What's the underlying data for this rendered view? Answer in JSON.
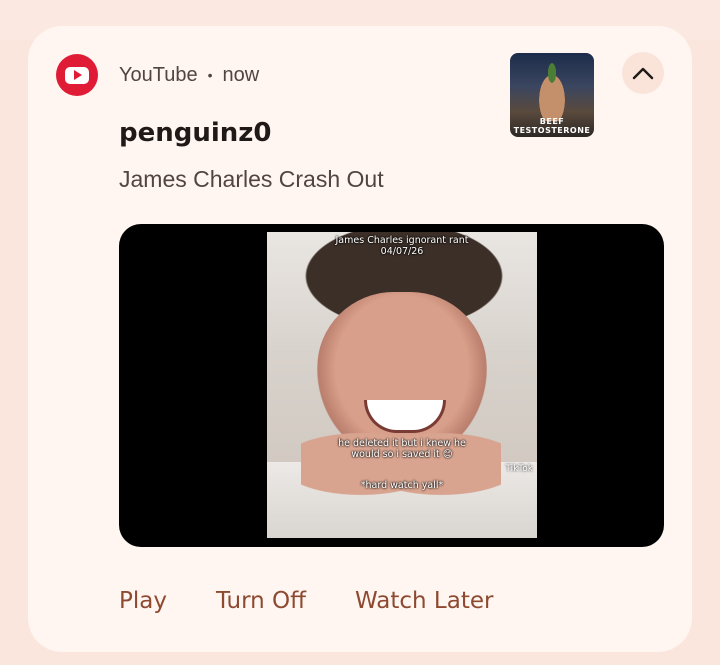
{
  "notification": {
    "app_name": "YouTube",
    "separator": "•",
    "time": "now",
    "title": "penguinz0",
    "body": "James Charles Crash Out",
    "thumbnail_caption": "BEEF\nTESTOSTERONE",
    "media_overlay_top": "James Charles ignorant rant\n04/07/26",
    "media_overlay_mid": "he deleted it but i knew he\nwould so i saved it 😊",
    "media_overlay_bottom": "*hard watch yall*",
    "media_watermark": "TikTok",
    "actions": [
      "Play",
      "Turn Off",
      "Watch Later"
    ]
  },
  "colors": {
    "accent": "#8e4a30",
    "app_icon": "#e01b35",
    "card": "#fff5f1",
    "background": "#fae6dd"
  },
  "icons": {
    "app": "youtube-icon",
    "expand": "chevron-up-icon"
  }
}
